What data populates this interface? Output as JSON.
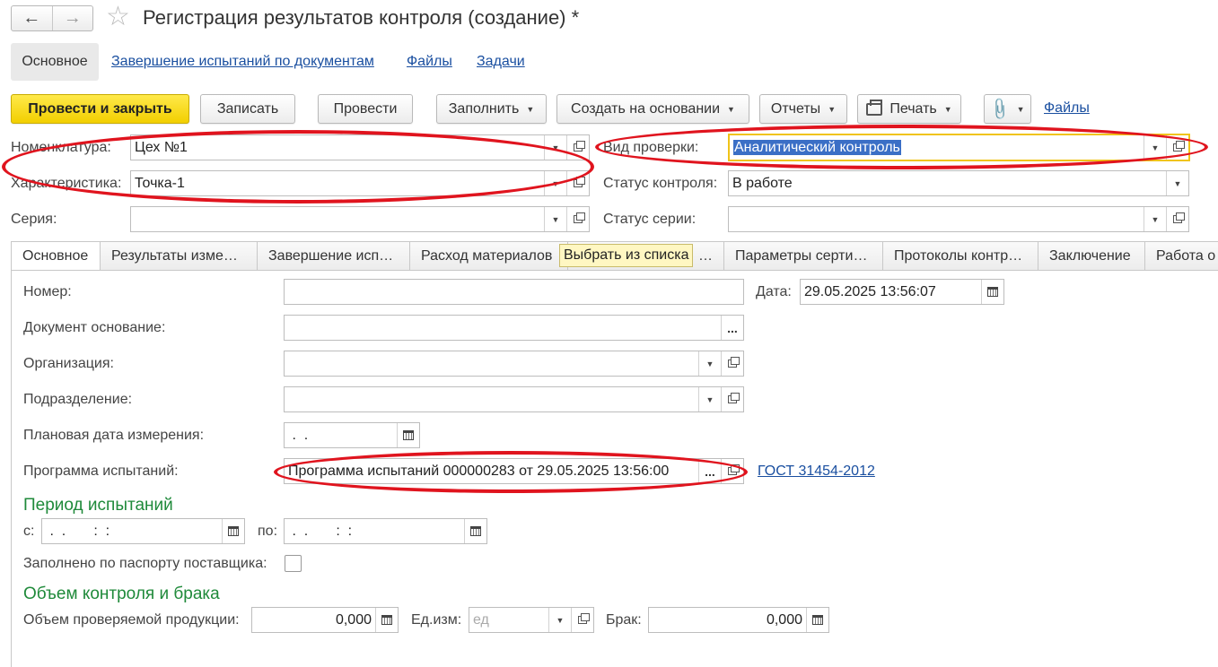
{
  "window": {
    "title": "Регистрация результатов контроля (создание) *"
  },
  "section_tabs": [
    {
      "label": "Основное"
    },
    {
      "label": "Завершение испытаний по документам"
    },
    {
      "label": "Файлы"
    },
    {
      "label": "Задачи"
    }
  ],
  "toolbar": {
    "post_close": "Провести и закрыть",
    "save": "Записать",
    "post": "Провести",
    "fill": "Заполнить",
    "create_based": "Создать на основании",
    "reports": "Отчеты",
    "print": "Печать",
    "files_link": "Файлы"
  },
  "header": {
    "nomenclature_label": "Номенклатура:",
    "nomenclature_value": "Цех №1",
    "characteristic_label": "Характеристика:",
    "characteristic_value": "Точка-1",
    "series_label": "Серия:",
    "series_value": "",
    "check_type_label": "Вид проверки:",
    "check_type_value": "Аналитический контроль",
    "control_status_label": "Статус контроля:",
    "control_status_value": "В работе",
    "series_status_label": "Статус серии:",
    "series_status_value": ""
  },
  "tabs": [
    {
      "label": "Основное"
    },
    {
      "label": "Результаты изме…"
    },
    {
      "label": "Завершение исп…"
    },
    {
      "label": "Расход материалов"
    },
    {
      "label": "…"
    },
    {
      "label": "Параметры серти…"
    },
    {
      "label": "Протоколы контр…"
    },
    {
      "label": "Заключение"
    },
    {
      "label": "Работа о"
    }
  ],
  "tooltip": "Выбрать из списка",
  "main": {
    "number_label": "Номер:",
    "number_value": "",
    "date_label": "Дата:",
    "date_value": "29.05.2025 13:56:07",
    "base_doc_label": "Документ основание:",
    "base_doc_value": "",
    "org_label": "Организация:",
    "org_value": "",
    "dept_label": "Подразделение:",
    "dept_value": "",
    "planned_date_label": "Плановая дата измерения:",
    "planned_date_value": " .  .",
    "program_label": "Программа испытаний:",
    "program_value": "Программа испытаний 000000283 от 29.05.2025 13:56:00",
    "gost_link": "ГОСТ 31454-2012"
  },
  "period": {
    "heading": "Период испытаний",
    "from_label": "с:",
    "from_value": " .  .       :  :",
    "to_label": "по:",
    "to_value": " .  .       :  :",
    "passport_label": "Заполнено по паспорту поставщика:"
  },
  "volume": {
    "heading": "Объем контроля и брака",
    "checked_label": "Объем проверяемой продукции:",
    "checked_value": "0,000",
    "unit_label": "Ед.изм:",
    "unit_placeholder": "ед",
    "defect_label": "Брак:",
    "defect_value": "0,000"
  },
  "colors": {
    "primary_button": "#f2cf00",
    "link": "#1a4fa0",
    "heading_green": "#1f8a3a",
    "annotation_red": "#e0141e",
    "selection": "#3b6fc6"
  }
}
